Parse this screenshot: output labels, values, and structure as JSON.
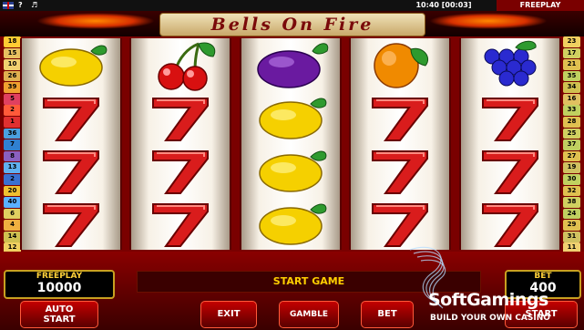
{
  "top_bar": {
    "question": "?",
    "time": "10:40 [00:03]",
    "mode": "FREEPLAY"
  },
  "title": "Bells On Fire",
  "paylines_left": [
    {
      "n": "18",
      "c": "#ffcc33"
    },
    {
      "n": "15",
      "c": "#e8c060"
    },
    {
      "n": "10",
      "c": "#f0d070"
    },
    {
      "n": "26",
      "c": "#e0b050"
    },
    {
      "n": "39",
      "c": "#f0a030"
    },
    {
      "n": "5",
      "c": "#e04060"
    },
    {
      "n": "2",
      "c": "#ff5a3a"
    },
    {
      "n": "1",
      "c": "#e03030"
    },
    {
      "n": "36",
      "c": "#4aa0e0"
    },
    {
      "n": "7",
      "c": "#3080d0"
    },
    {
      "n": "8",
      "c": "#8a60c0"
    },
    {
      "n": "13",
      "c": "#60b0f0"
    },
    {
      "n": "2",
      "c": "#3a70d0"
    },
    {
      "n": "20",
      "c": "#f0c030"
    },
    {
      "n": "40",
      "c": "#5ab0ff"
    },
    {
      "n": "6",
      "c": "#e0d060"
    },
    {
      "n": "4",
      "c": "#f0b040"
    },
    {
      "n": "14",
      "c": "#d0c050"
    },
    {
      "n": "12",
      "c": "#f0d060"
    }
  ],
  "paylines_right": [
    {
      "n": "23",
      "c": "#f0d060"
    },
    {
      "n": "17",
      "c": "#d0d060"
    },
    {
      "n": "21",
      "c": "#e0c050"
    },
    {
      "n": "35",
      "c": "#c0d060"
    },
    {
      "n": "34",
      "c": "#d0c050"
    },
    {
      "n": "16",
      "c": "#e0c060"
    },
    {
      "n": "33",
      "c": "#c0d060"
    },
    {
      "n": "28",
      "c": "#e0c050"
    },
    {
      "n": "25",
      "c": "#d0d060"
    },
    {
      "n": "37",
      "c": "#c0d060"
    },
    {
      "n": "27",
      "c": "#e0c050"
    },
    {
      "n": "19",
      "c": "#d0c060"
    },
    {
      "n": "30",
      "c": "#c0d060"
    },
    {
      "n": "32",
      "c": "#e0c050"
    },
    {
      "n": "38",
      "c": "#d0d060"
    },
    {
      "n": "24",
      "c": "#c0d060"
    },
    {
      "n": "29",
      "c": "#e0c050"
    },
    {
      "n": "31",
      "c": "#d0c060"
    },
    {
      "n": "11",
      "c": "#f0d070"
    }
  ],
  "reels": [
    [
      "lemon",
      "seven",
      "seven",
      "seven"
    ],
    [
      "cherry",
      "seven",
      "seven",
      "seven"
    ],
    [
      "plum",
      "lemon",
      "lemon",
      "lemon"
    ],
    [
      "orange",
      "seven",
      "seven",
      "seven"
    ],
    [
      "grapes",
      "seven",
      "seven",
      "seven"
    ]
  ],
  "freeplay": {
    "label": "FREEPLAY",
    "value": "10000"
  },
  "bet": {
    "label": "BET",
    "value": "400"
  },
  "message": "START GAME",
  "buttons": {
    "auto_start_1": "AUTO",
    "auto_start_2": "START",
    "exit": "EXIT",
    "gamble": "GAMBLE",
    "bet": "BET",
    "start": "START"
  },
  "branding": {
    "name": "SoftGamings",
    "tagline": "BUILD YOUR OWN CASINO"
  }
}
